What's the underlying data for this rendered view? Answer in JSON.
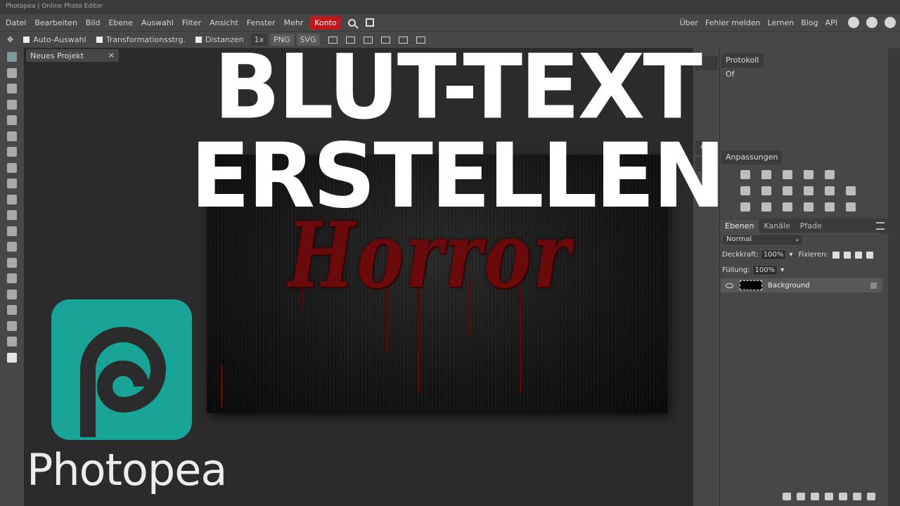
{
  "window": {
    "title": "Photopea | Online Photo Editor"
  },
  "menu": {
    "items": [
      "Datei",
      "Bearbeiten",
      "Bild",
      "Ebene",
      "Auswahl",
      "Filter",
      "Ansicht",
      "Fenster",
      "Mehr"
    ],
    "account": "Konto",
    "right_links": [
      "Über",
      "Fehler melden",
      "Lernen",
      "Blog",
      "API"
    ]
  },
  "options": {
    "auto_select": "Auto-Auswahl",
    "transform_controls": "Transformationsstrg.",
    "distances": "Distanzen",
    "zoom": "1x",
    "export_png": "PNG",
    "export_svg": "SVG"
  },
  "document": {
    "tab": "Neues Projekt",
    "close": "×",
    "artwork_text": "Horror"
  },
  "overlay": {
    "headline": "BLUT-TEXT ERSTELLEN",
    "brand": "Photopea"
  },
  "side_strip": {
    "css_label": "CSS"
  },
  "panels": {
    "top_tabs": [
      "Protokoll",
      "Of"
    ],
    "adjustments_title": "Anpassungen",
    "layer_tabs": [
      "Ebenen",
      "Kanäle",
      "Pfade"
    ],
    "blend_mode": "Normal",
    "opacity_label": "Deckkraft:",
    "opacity_value": "100%",
    "lock_label": "Fixieren:",
    "fill_label": "Füllung:",
    "fill_value": "100%",
    "layer_name": "Background"
  },
  "colors": {
    "accent": "#c4161c",
    "logo": "#18a497",
    "blood": "#6b0a0a"
  }
}
